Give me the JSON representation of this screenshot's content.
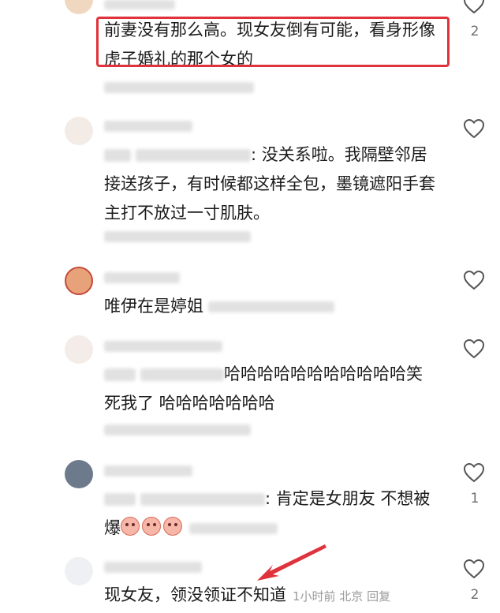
{
  "comments": [
    {
      "text": "前妻没有那么高。现女友倒有可能，看身形像虎子婚礼的那个女的",
      "like_count": "2"
    },
    {
      "text_prefix": "回复",
      "text": ": 没关系啦。我隔壁邻居接送孩子，有时候都这样全包，墨镜遮阳手套主打不放过一寸肌肤。",
      "like_count": ""
    },
    {
      "text": "唯伊在是婷姐",
      "like_count": ""
    },
    {
      "text": "哈哈哈哈哈哈哈哈哈哈哈笑死我了 哈哈哈哈哈哈哈",
      "like_count": ""
    },
    {
      "text": ": 肯定是女朋友 不想被爆",
      "like_count": "1"
    },
    {
      "text": "现女友，领没领证不知道",
      "meta": "1小时前 北京 回复",
      "like_count": "2"
    }
  ],
  "colors": {
    "highlight": "#e0323c",
    "heart_stroke": "#555555"
  },
  "icons": {
    "like": "heart-outline-icon",
    "annotation": "red-arrow-icon"
  }
}
